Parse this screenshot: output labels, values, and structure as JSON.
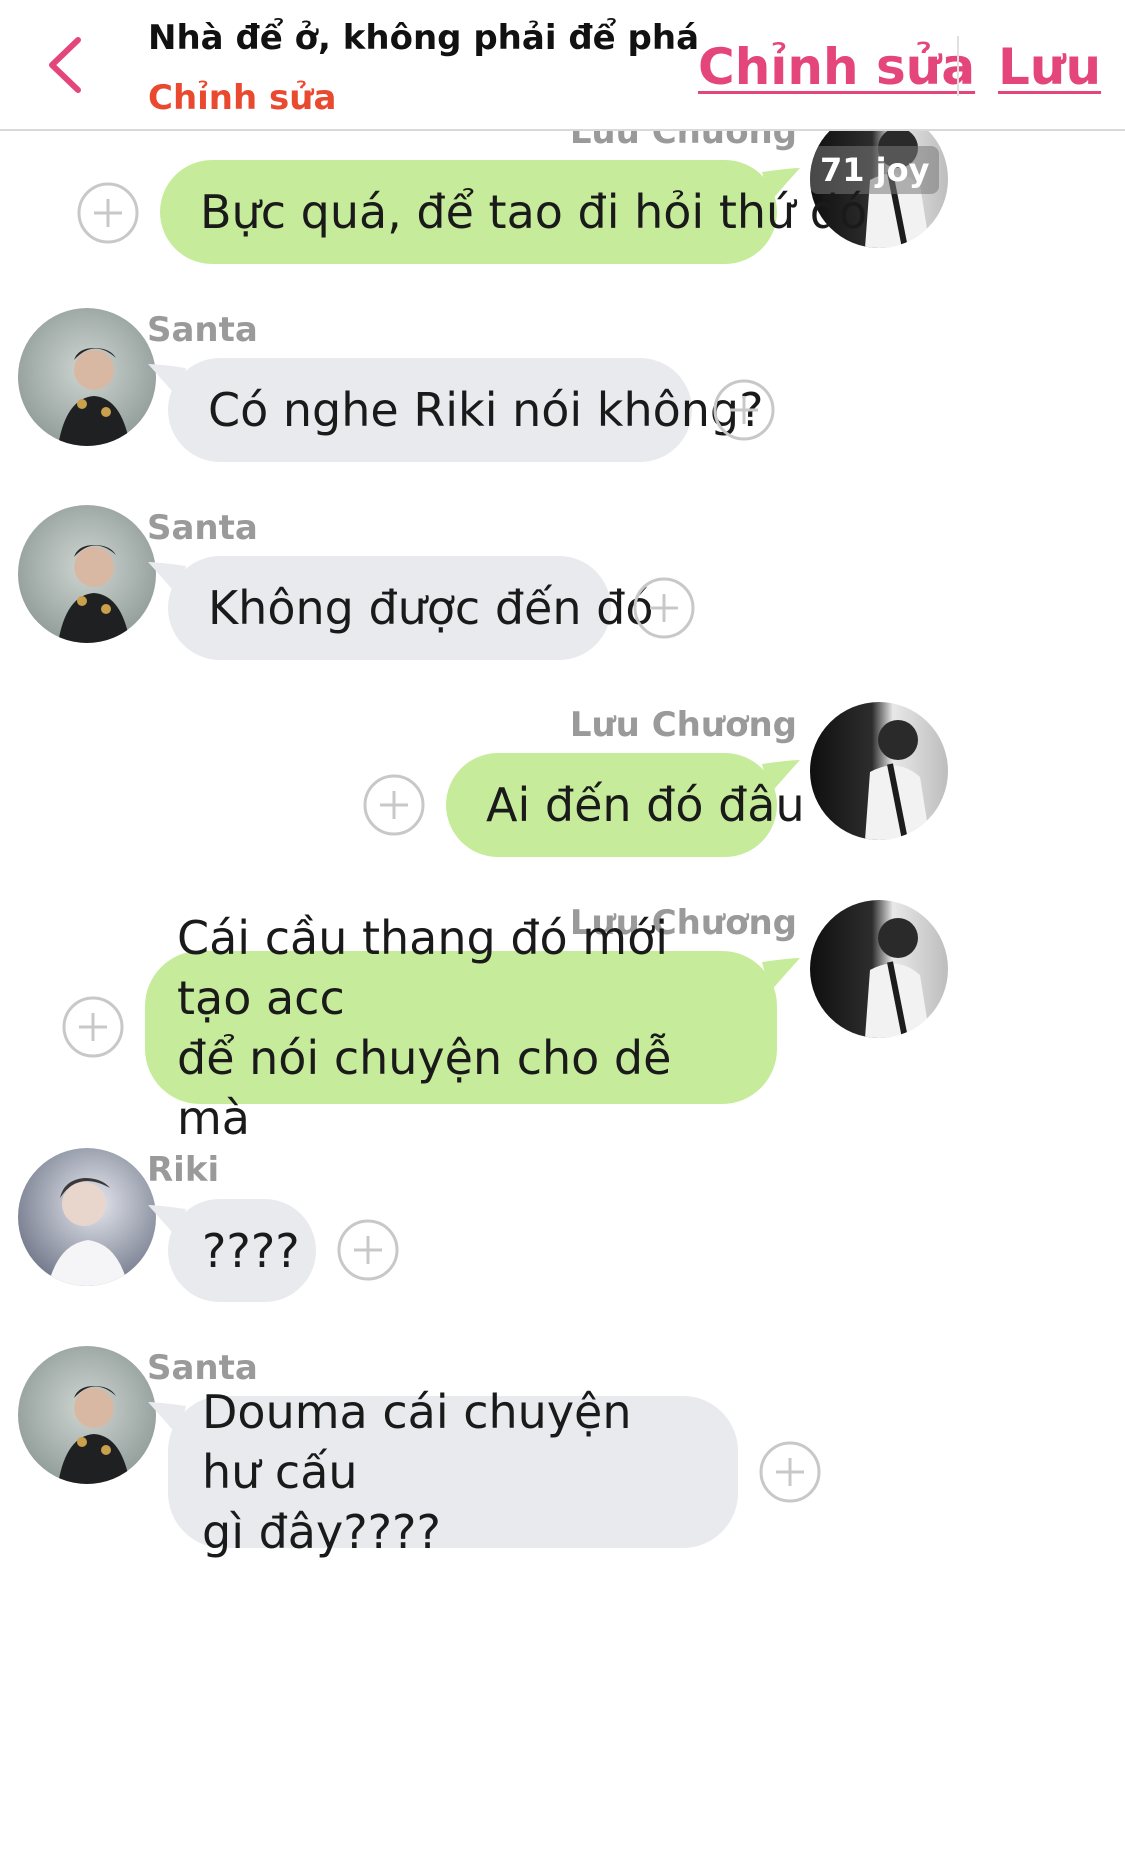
{
  "header": {
    "title": "Nhà để ở, không phải để phá",
    "subtitle": "Chỉnh sửa",
    "edit_label": "Chỉnh sửa",
    "save_label": "Lưu",
    "accent_color": "#e4457b",
    "subtitle_color": "#e8492f"
  },
  "messages": [
    {
      "sender": "Lưu Chương",
      "text": "Bực quá, để tao đi hỏi thứ đó",
      "side": "right",
      "time_badge": "71 joy"
    },
    {
      "sender": "Santa",
      "text": "Có nghe Riki nói không?",
      "side": "left"
    },
    {
      "sender": "Santa",
      "text": "Không được đến đó",
      "side": "left"
    },
    {
      "sender": "Lưu Chương",
      "text": "Ai đến đó đâu",
      "side": "right"
    },
    {
      "sender": "Lưu Chương",
      "text": "Cái cầu thang đó mới tạo acc\nđể nói chuyện cho dễ mà",
      "side": "right"
    },
    {
      "sender": "Riki",
      "text": "????",
      "side": "left"
    },
    {
      "sender": "Santa",
      "text": "Douma cái chuyện hư cấu\ngì đây????",
      "side": "left"
    }
  ],
  "colors": {
    "outgoing_bubble": "#c6ec9b",
    "incoming_bubble": "#e9eaee",
    "sender_name": "#9a9a9a"
  },
  "icons": {
    "back": "chevron-left-icon",
    "add_reaction": "plus-circle-icon"
  }
}
